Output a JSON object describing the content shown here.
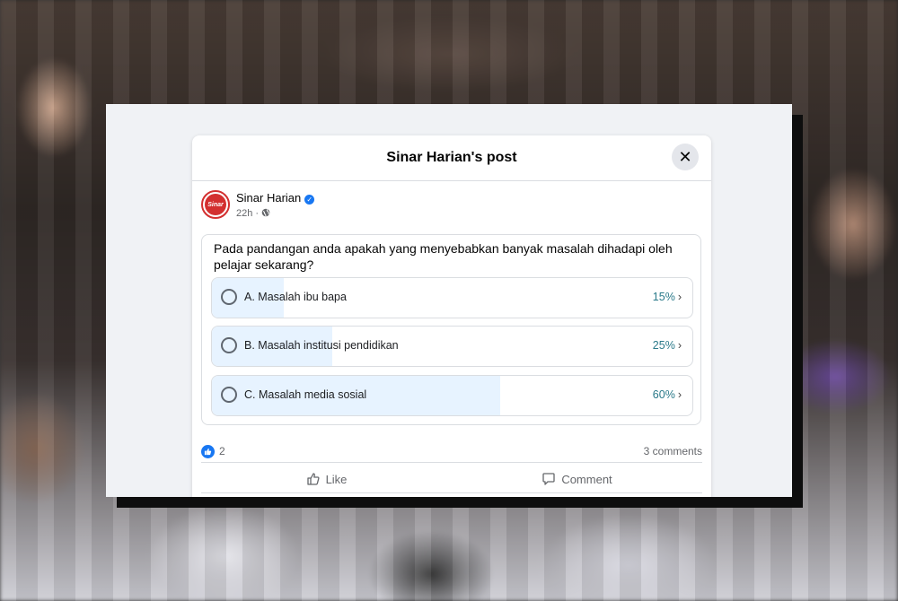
{
  "dialog": {
    "title": "Sinar Harian's post",
    "close_label": "✕"
  },
  "post": {
    "author": "Sinar Harian",
    "avatar_text": "Sinar",
    "time": "22h · ",
    "privacy_icon": "globe-icon"
  },
  "poll": {
    "question": "Pada pandangan anda apakah yang menyebabkan banyak masalah dihadapi oleh pelajar sekarang?",
    "options": [
      {
        "label": "A. Masalah ibu bapa",
        "percent_text": "15%",
        "percent": 15
      },
      {
        "label": "B. Masalah institusi pendidikan",
        "percent_text": "25%",
        "percent": 25
      },
      {
        "label": "C. Masalah media sosial",
        "percent_text": "60%",
        "percent": 60
      }
    ]
  },
  "engagement": {
    "like_count": "2",
    "comments": "3 comments"
  },
  "actions": {
    "like": "Like",
    "comment": "Comment"
  },
  "colors": {
    "accent": "#1877f2",
    "fill": "#e7f3ff",
    "percent_text": "#2b7a8a"
  }
}
